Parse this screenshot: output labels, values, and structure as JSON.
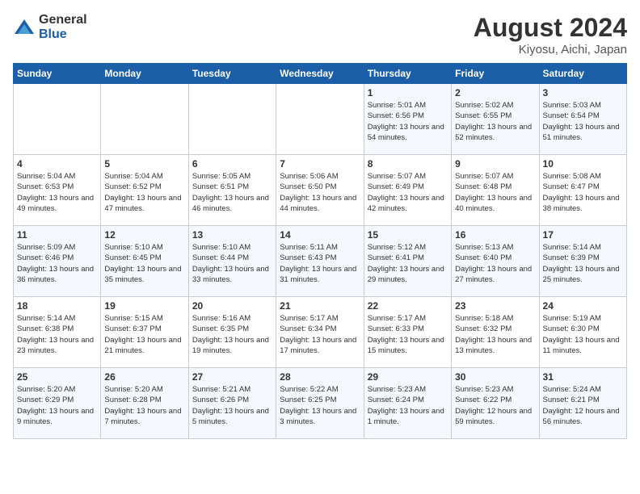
{
  "header": {
    "logo_general": "General",
    "logo_blue": "Blue",
    "month_title": "August 2024",
    "location": "Kiyosu, Aichi, Japan"
  },
  "weekdays": [
    "Sunday",
    "Monday",
    "Tuesday",
    "Wednesday",
    "Thursday",
    "Friday",
    "Saturday"
  ],
  "weeks": [
    [
      {
        "day": "",
        "info": ""
      },
      {
        "day": "",
        "info": ""
      },
      {
        "day": "",
        "info": ""
      },
      {
        "day": "",
        "info": ""
      },
      {
        "day": "1",
        "info": "Sunrise: 5:01 AM\nSunset: 6:56 PM\nDaylight: 13 hours\nand 54 minutes."
      },
      {
        "day": "2",
        "info": "Sunrise: 5:02 AM\nSunset: 6:55 PM\nDaylight: 13 hours\nand 52 minutes."
      },
      {
        "day": "3",
        "info": "Sunrise: 5:03 AM\nSunset: 6:54 PM\nDaylight: 13 hours\nand 51 minutes."
      }
    ],
    [
      {
        "day": "4",
        "info": "Sunrise: 5:04 AM\nSunset: 6:53 PM\nDaylight: 13 hours\nand 49 minutes."
      },
      {
        "day": "5",
        "info": "Sunrise: 5:04 AM\nSunset: 6:52 PM\nDaylight: 13 hours\nand 47 minutes."
      },
      {
        "day": "6",
        "info": "Sunrise: 5:05 AM\nSunset: 6:51 PM\nDaylight: 13 hours\nand 46 minutes."
      },
      {
        "day": "7",
        "info": "Sunrise: 5:06 AM\nSunset: 6:50 PM\nDaylight: 13 hours\nand 44 minutes."
      },
      {
        "day": "8",
        "info": "Sunrise: 5:07 AM\nSunset: 6:49 PM\nDaylight: 13 hours\nand 42 minutes."
      },
      {
        "day": "9",
        "info": "Sunrise: 5:07 AM\nSunset: 6:48 PM\nDaylight: 13 hours\nand 40 minutes."
      },
      {
        "day": "10",
        "info": "Sunrise: 5:08 AM\nSunset: 6:47 PM\nDaylight: 13 hours\nand 38 minutes."
      }
    ],
    [
      {
        "day": "11",
        "info": "Sunrise: 5:09 AM\nSunset: 6:46 PM\nDaylight: 13 hours\nand 36 minutes."
      },
      {
        "day": "12",
        "info": "Sunrise: 5:10 AM\nSunset: 6:45 PM\nDaylight: 13 hours\nand 35 minutes."
      },
      {
        "day": "13",
        "info": "Sunrise: 5:10 AM\nSunset: 6:44 PM\nDaylight: 13 hours\nand 33 minutes."
      },
      {
        "day": "14",
        "info": "Sunrise: 5:11 AM\nSunset: 6:43 PM\nDaylight: 13 hours\nand 31 minutes."
      },
      {
        "day": "15",
        "info": "Sunrise: 5:12 AM\nSunset: 6:41 PM\nDaylight: 13 hours\nand 29 minutes."
      },
      {
        "day": "16",
        "info": "Sunrise: 5:13 AM\nSunset: 6:40 PM\nDaylight: 13 hours\nand 27 minutes."
      },
      {
        "day": "17",
        "info": "Sunrise: 5:14 AM\nSunset: 6:39 PM\nDaylight: 13 hours\nand 25 minutes."
      }
    ],
    [
      {
        "day": "18",
        "info": "Sunrise: 5:14 AM\nSunset: 6:38 PM\nDaylight: 13 hours\nand 23 minutes."
      },
      {
        "day": "19",
        "info": "Sunrise: 5:15 AM\nSunset: 6:37 PM\nDaylight: 13 hours\nand 21 minutes."
      },
      {
        "day": "20",
        "info": "Sunrise: 5:16 AM\nSunset: 6:35 PM\nDaylight: 13 hours\nand 19 minutes."
      },
      {
        "day": "21",
        "info": "Sunrise: 5:17 AM\nSunset: 6:34 PM\nDaylight: 13 hours\nand 17 minutes."
      },
      {
        "day": "22",
        "info": "Sunrise: 5:17 AM\nSunset: 6:33 PM\nDaylight: 13 hours\nand 15 minutes."
      },
      {
        "day": "23",
        "info": "Sunrise: 5:18 AM\nSunset: 6:32 PM\nDaylight: 13 hours\nand 13 minutes."
      },
      {
        "day": "24",
        "info": "Sunrise: 5:19 AM\nSunset: 6:30 PM\nDaylight: 13 hours\nand 11 minutes."
      }
    ],
    [
      {
        "day": "25",
        "info": "Sunrise: 5:20 AM\nSunset: 6:29 PM\nDaylight: 13 hours\nand 9 minutes."
      },
      {
        "day": "26",
        "info": "Sunrise: 5:20 AM\nSunset: 6:28 PM\nDaylight: 13 hours\nand 7 minutes."
      },
      {
        "day": "27",
        "info": "Sunrise: 5:21 AM\nSunset: 6:26 PM\nDaylight: 13 hours\nand 5 minutes."
      },
      {
        "day": "28",
        "info": "Sunrise: 5:22 AM\nSunset: 6:25 PM\nDaylight: 13 hours\nand 3 minutes."
      },
      {
        "day": "29",
        "info": "Sunrise: 5:23 AM\nSunset: 6:24 PM\nDaylight: 13 hours\nand 1 minute."
      },
      {
        "day": "30",
        "info": "Sunrise: 5:23 AM\nSunset: 6:22 PM\nDaylight: 12 hours\nand 59 minutes."
      },
      {
        "day": "31",
        "info": "Sunrise: 5:24 AM\nSunset: 6:21 PM\nDaylight: 12 hours\nand 56 minutes."
      }
    ]
  ]
}
